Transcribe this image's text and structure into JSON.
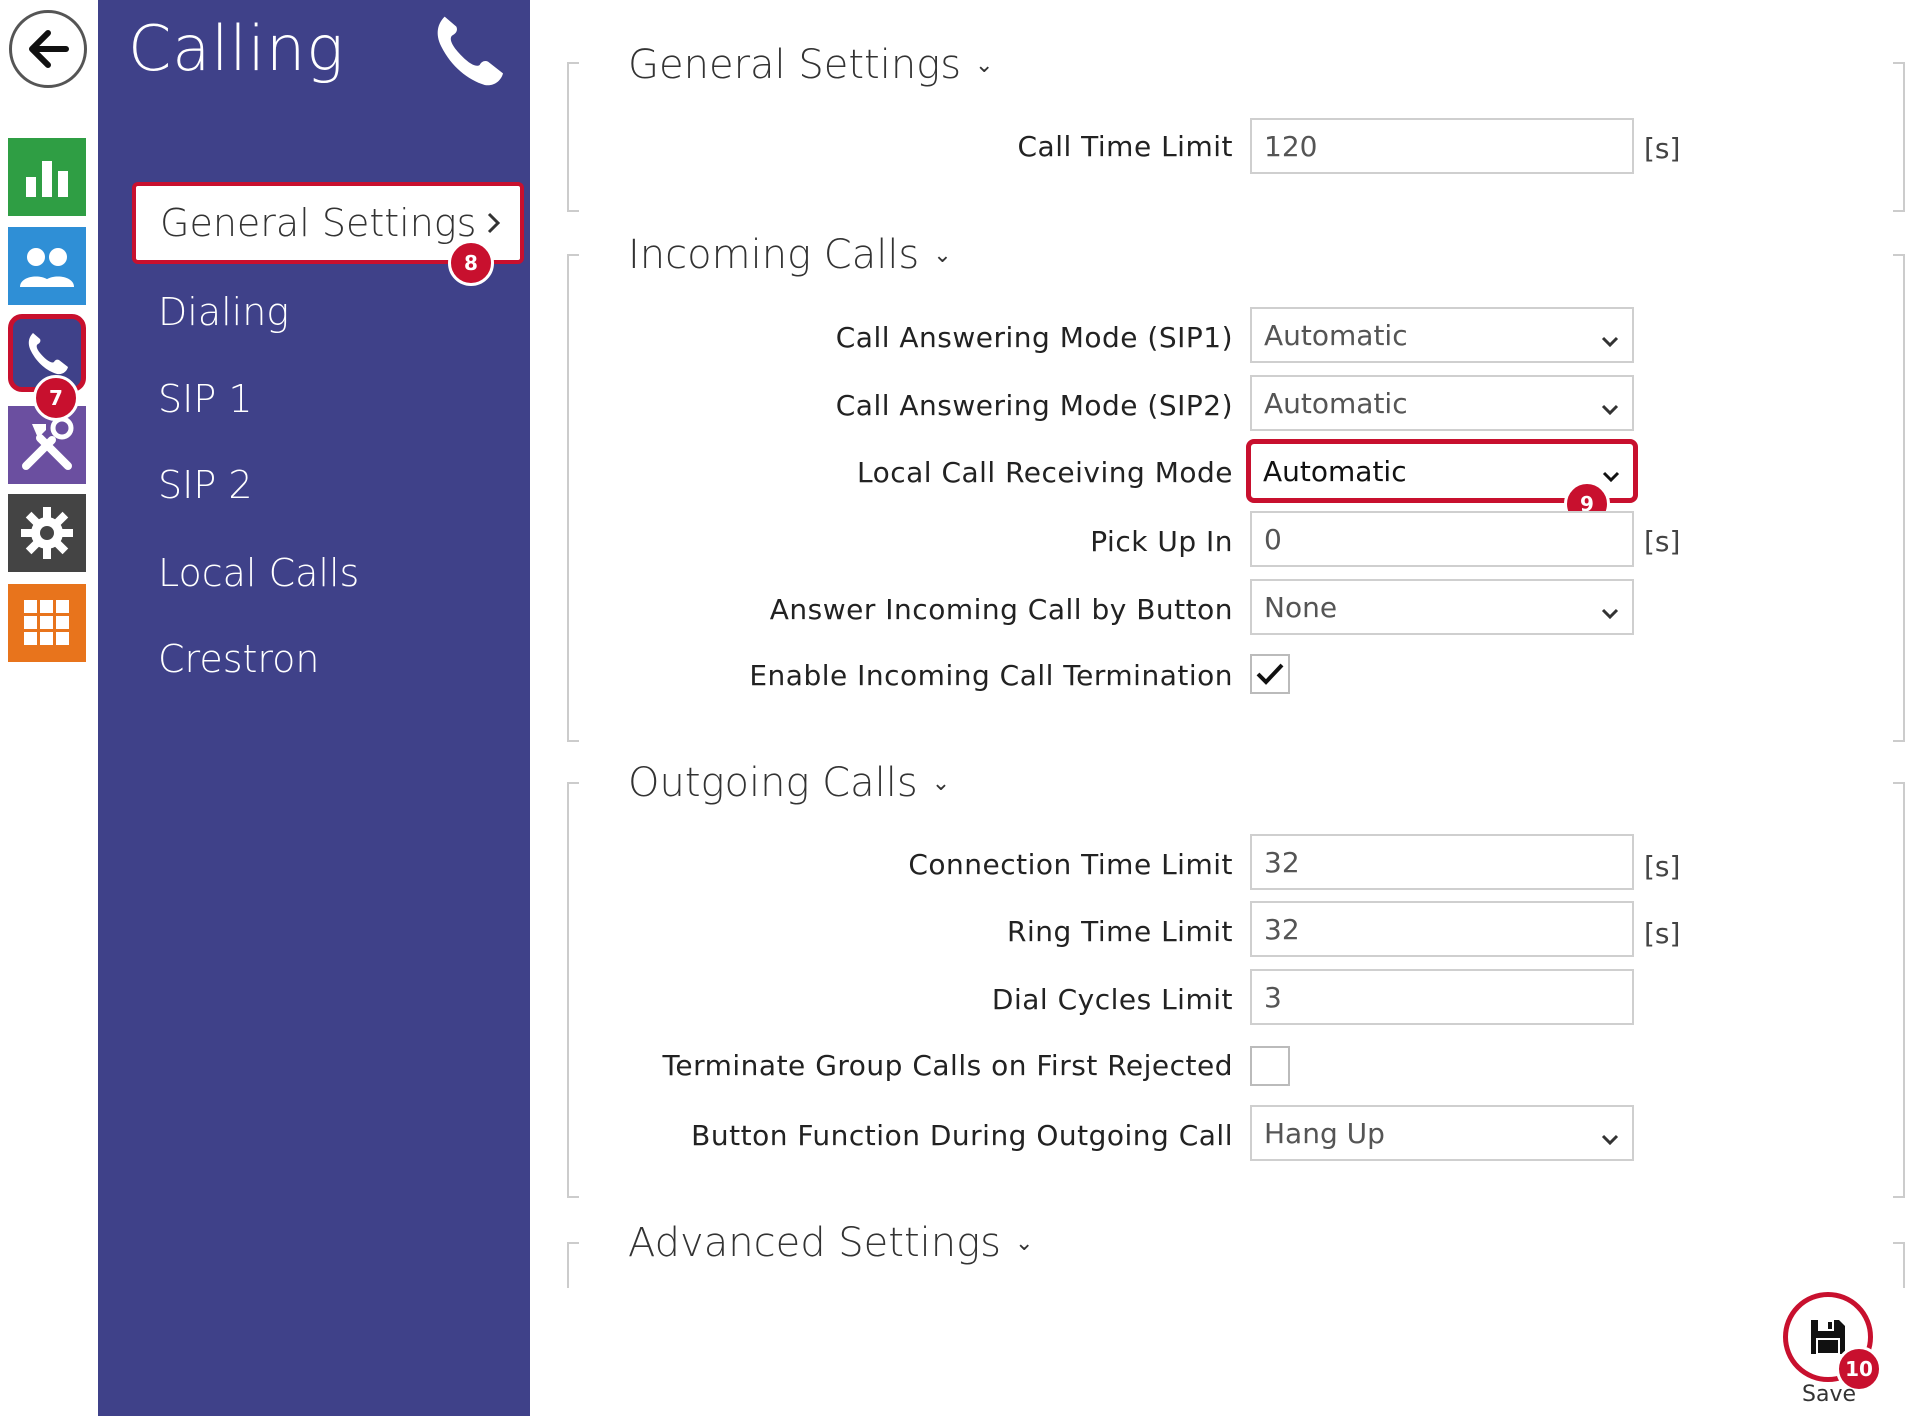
{
  "sidebar": {
    "title": "Calling",
    "items": [
      {
        "label": "General Settings"
      },
      {
        "label": "Dialing"
      },
      {
        "label": "SIP 1"
      },
      {
        "label": "SIP 2"
      },
      {
        "label": "Local Calls"
      },
      {
        "label": "Crestron"
      }
    ]
  },
  "rail": {
    "icons": [
      "back-arrow-icon",
      "bar-chart-icon",
      "users-icon",
      "phone-icon",
      "tools-icon",
      "gear-icon",
      "apps-grid-icon"
    ],
    "colors": {
      "stats": "#2f9e44",
      "users": "#2f8fd6",
      "calling": "#3f4189",
      "tools": "#6b4fa0",
      "settings": "#444444",
      "apps": "#e8741c"
    }
  },
  "badges": {
    "b7": "7",
    "b8": "8",
    "b9": "9",
    "b10": "10"
  },
  "sections": {
    "general": {
      "title": "General Settings",
      "call_time_limit": {
        "label": "Call Time Limit",
        "value": "120",
        "unit": "[s]"
      }
    },
    "incoming": {
      "title": "Incoming Calls",
      "sip1_mode": {
        "label": "Call Answering Mode (SIP1)",
        "value": "Automatic"
      },
      "sip2_mode": {
        "label": "Call Answering Mode (SIP2)",
        "value": "Automatic"
      },
      "local_mode": {
        "label": "Local Call Receiving Mode",
        "value": "Automatic"
      },
      "pick_up_in": {
        "label": "Pick Up In",
        "value": "0",
        "unit": "[s]"
      },
      "answer_button": {
        "label": "Answer Incoming Call by Button",
        "value": "None"
      },
      "termination": {
        "label": "Enable Incoming Call Termination",
        "checked": true
      }
    },
    "outgoing": {
      "title": "Outgoing Calls",
      "connection_limit": {
        "label": "Connection Time Limit",
        "value": "32",
        "unit": "[s]"
      },
      "ring_limit": {
        "label": "Ring Time Limit",
        "value": "32",
        "unit": "[s]"
      },
      "dial_cycles": {
        "label": "Dial Cycles Limit",
        "value": "3"
      },
      "terminate_group": {
        "label": "Terminate Group Calls on First Rejected",
        "checked": false
      },
      "button_function": {
        "label": "Button Function During Outgoing Call",
        "value": "Hang Up"
      }
    },
    "advanced": {
      "title": "Advanced Settings"
    }
  },
  "save": {
    "label": "Save"
  },
  "colors": {
    "accent": "#c8102e",
    "sidebar": "#3f4189"
  }
}
